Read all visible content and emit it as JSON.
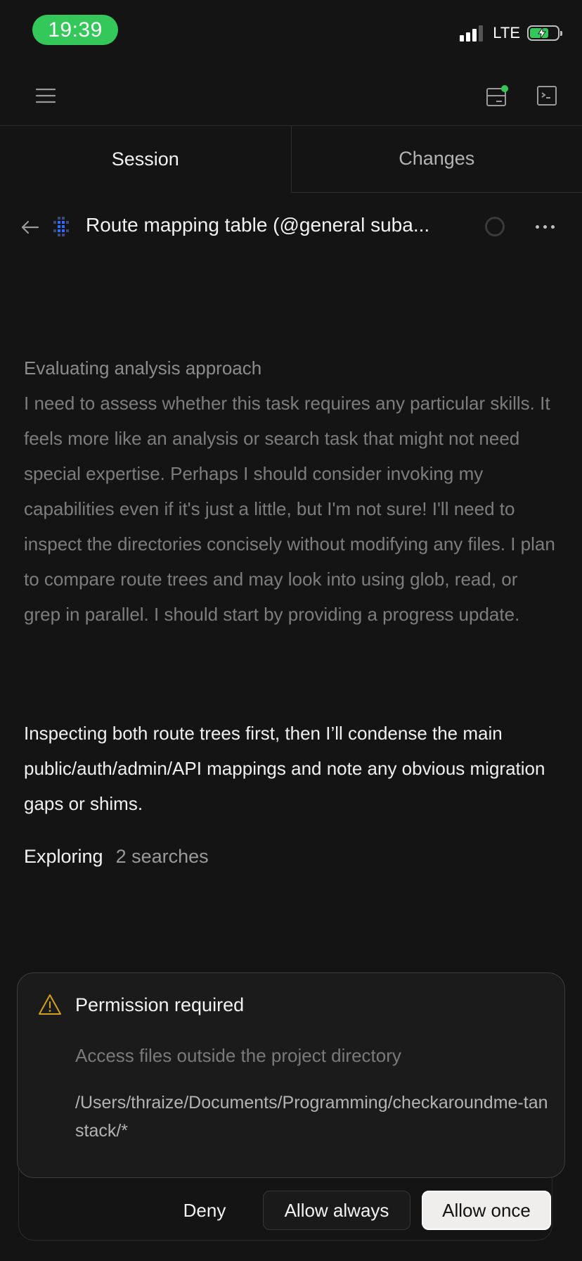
{
  "status_bar": {
    "time": "19:39",
    "network": "LTE",
    "time_pill_color": "#34c759",
    "battery_color": "#34c759"
  },
  "toolbar": {
    "menu_icon": "hamburger-menu-icon",
    "review_icon": "review-panel-icon",
    "review_indicator_color": "#34c759",
    "terminal_icon": "terminal-icon"
  },
  "tabs": [
    {
      "label": "Session",
      "active": true
    },
    {
      "label": "Changes",
      "active": false
    }
  ],
  "session": {
    "title": "Route mapping table (@general suba...",
    "back_icon": "arrow-left-icon",
    "agent_icon": "agent-grid-icon",
    "status_icon": "status-ring-icon",
    "more_icon": "more-horizontal-icon"
  },
  "reasoning": {
    "heading": "Evaluating analysis approach",
    "body": "I need to assess whether this task requires any particular skills. It feels more like an analysis or search task that might not need special expertise. Perhaps I should consider invoking my capabilities even if it's just a little, but I'm not sure! I'll need to inspect the directories concisely without modifying any files. I plan to compare route trees and may look into using glob, read, or grep in parallel. I should start by providing a progress update."
  },
  "message": {
    "text": "Inspecting both route trees first, then I’ll condense the main public/auth/admin/API mappings and note any obvious migration gaps or shims."
  },
  "exploring": {
    "label": "Exploring",
    "count": "2 searches"
  },
  "permission": {
    "icon": "warning-triangle-icon",
    "icon_color": "#d4a017",
    "title": "Permission required",
    "description": "Access files outside the project directory",
    "path": "/Users/thraize/Documents/Programming/checkaroundme-tanstack/*",
    "buttons": {
      "deny": "Deny",
      "allow_always": "Allow always",
      "allow_once": "Allow once"
    }
  }
}
